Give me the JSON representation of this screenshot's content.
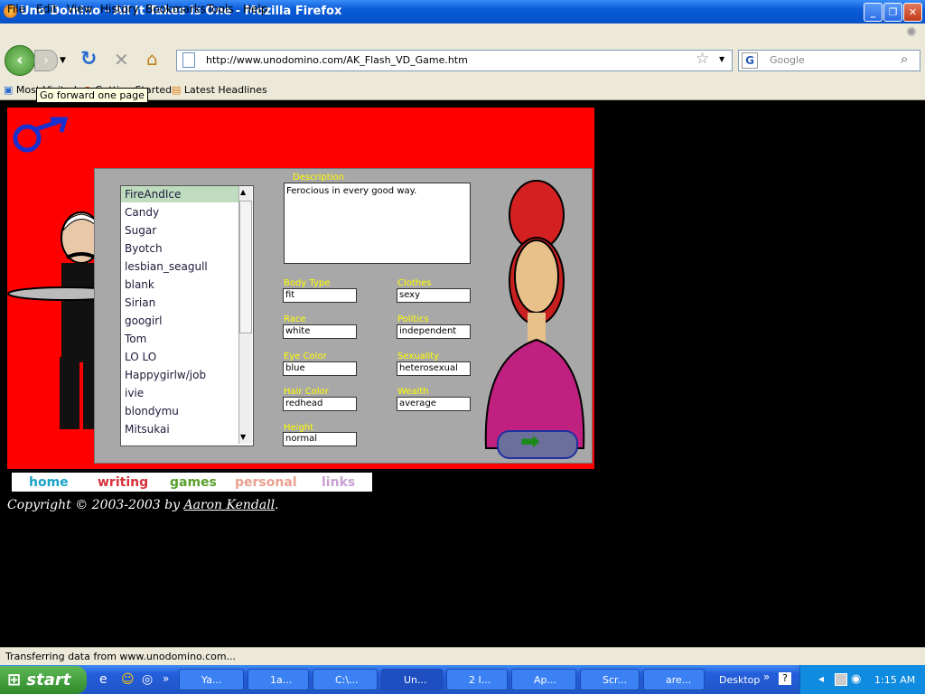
{
  "window": {
    "title": "Uno Domino - All It Takes Is One - Mozilla Firefox",
    "minimize": "_",
    "maximize": "❐",
    "close": "✕"
  },
  "menu": [
    "File",
    "Edit",
    "View",
    "History",
    "Bookmarks",
    "Tools",
    "Help"
  ],
  "nav": {
    "url": "http://www.unodomino.com/AK_Flash_VD_Game.htm",
    "search_placeholder": "Google",
    "tooltip": "Go forward one page"
  },
  "bookmarks": [
    "Most Visited",
    "Getting Started",
    "Latest Headlines"
  ],
  "game": {
    "names": [
      "FireAndIce",
      "Candy",
      "Sugar",
      "Byotch",
      "lesbian_seagull",
      "blank",
      "Sirian",
      "googirl",
      "Tom",
      "LO LO",
      "Happygirlw/job",
      "ivie",
      "blondymu",
      "Mitsukai"
    ],
    "description_label": "Description",
    "description": "Ferocious in every good way.",
    "fields": {
      "body_type": {
        "label": "Body Type",
        "value": "fit"
      },
      "clothes": {
        "label": "Clothes",
        "value": "sexy"
      },
      "race": {
        "label": "Race",
        "value": "white"
      },
      "politics": {
        "label": "Politics",
        "value": "independent"
      },
      "eye_color": {
        "label": "Eye Color",
        "value": "blue"
      },
      "sexuality": {
        "label": "Sexuality",
        "value": "heterosexual"
      },
      "hair_color": {
        "label": "Hair Color",
        "value": "redhead"
      },
      "wealth": {
        "label": "Wealth",
        "value": "average"
      },
      "height": {
        "label": "Height",
        "value": "normal"
      }
    }
  },
  "site_links": [
    {
      "label": "home",
      "color": "#1aa3c8"
    },
    {
      "label": "writing",
      "color": "#d8323a"
    },
    {
      "label": "games",
      "color": "#5aa02c"
    },
    {
      "label": "personal",
      "color": "#e8a090"
    },
    {
      "label": "links",
      "color": "#c8a0d0"
    }
  ],
  "footer": {
    "copyright": "Copyright © 2003-2003 by ",
    "author": "Aaron Kendall",
    "period": "."
  },
  "status": "Transferring data from www.unodomino.com...",
  "taskbar": {
    "start": "start",
    "tasks": [
      "Ya...",
      "1a...",
      "C:\\...",
      "Un...",
      "2 I...",
      "Ap...",
      "Scr...",
      "are..."
    ],
    "desktop": "Desktop",
    "clock": "1:15 AM"
  }
}
